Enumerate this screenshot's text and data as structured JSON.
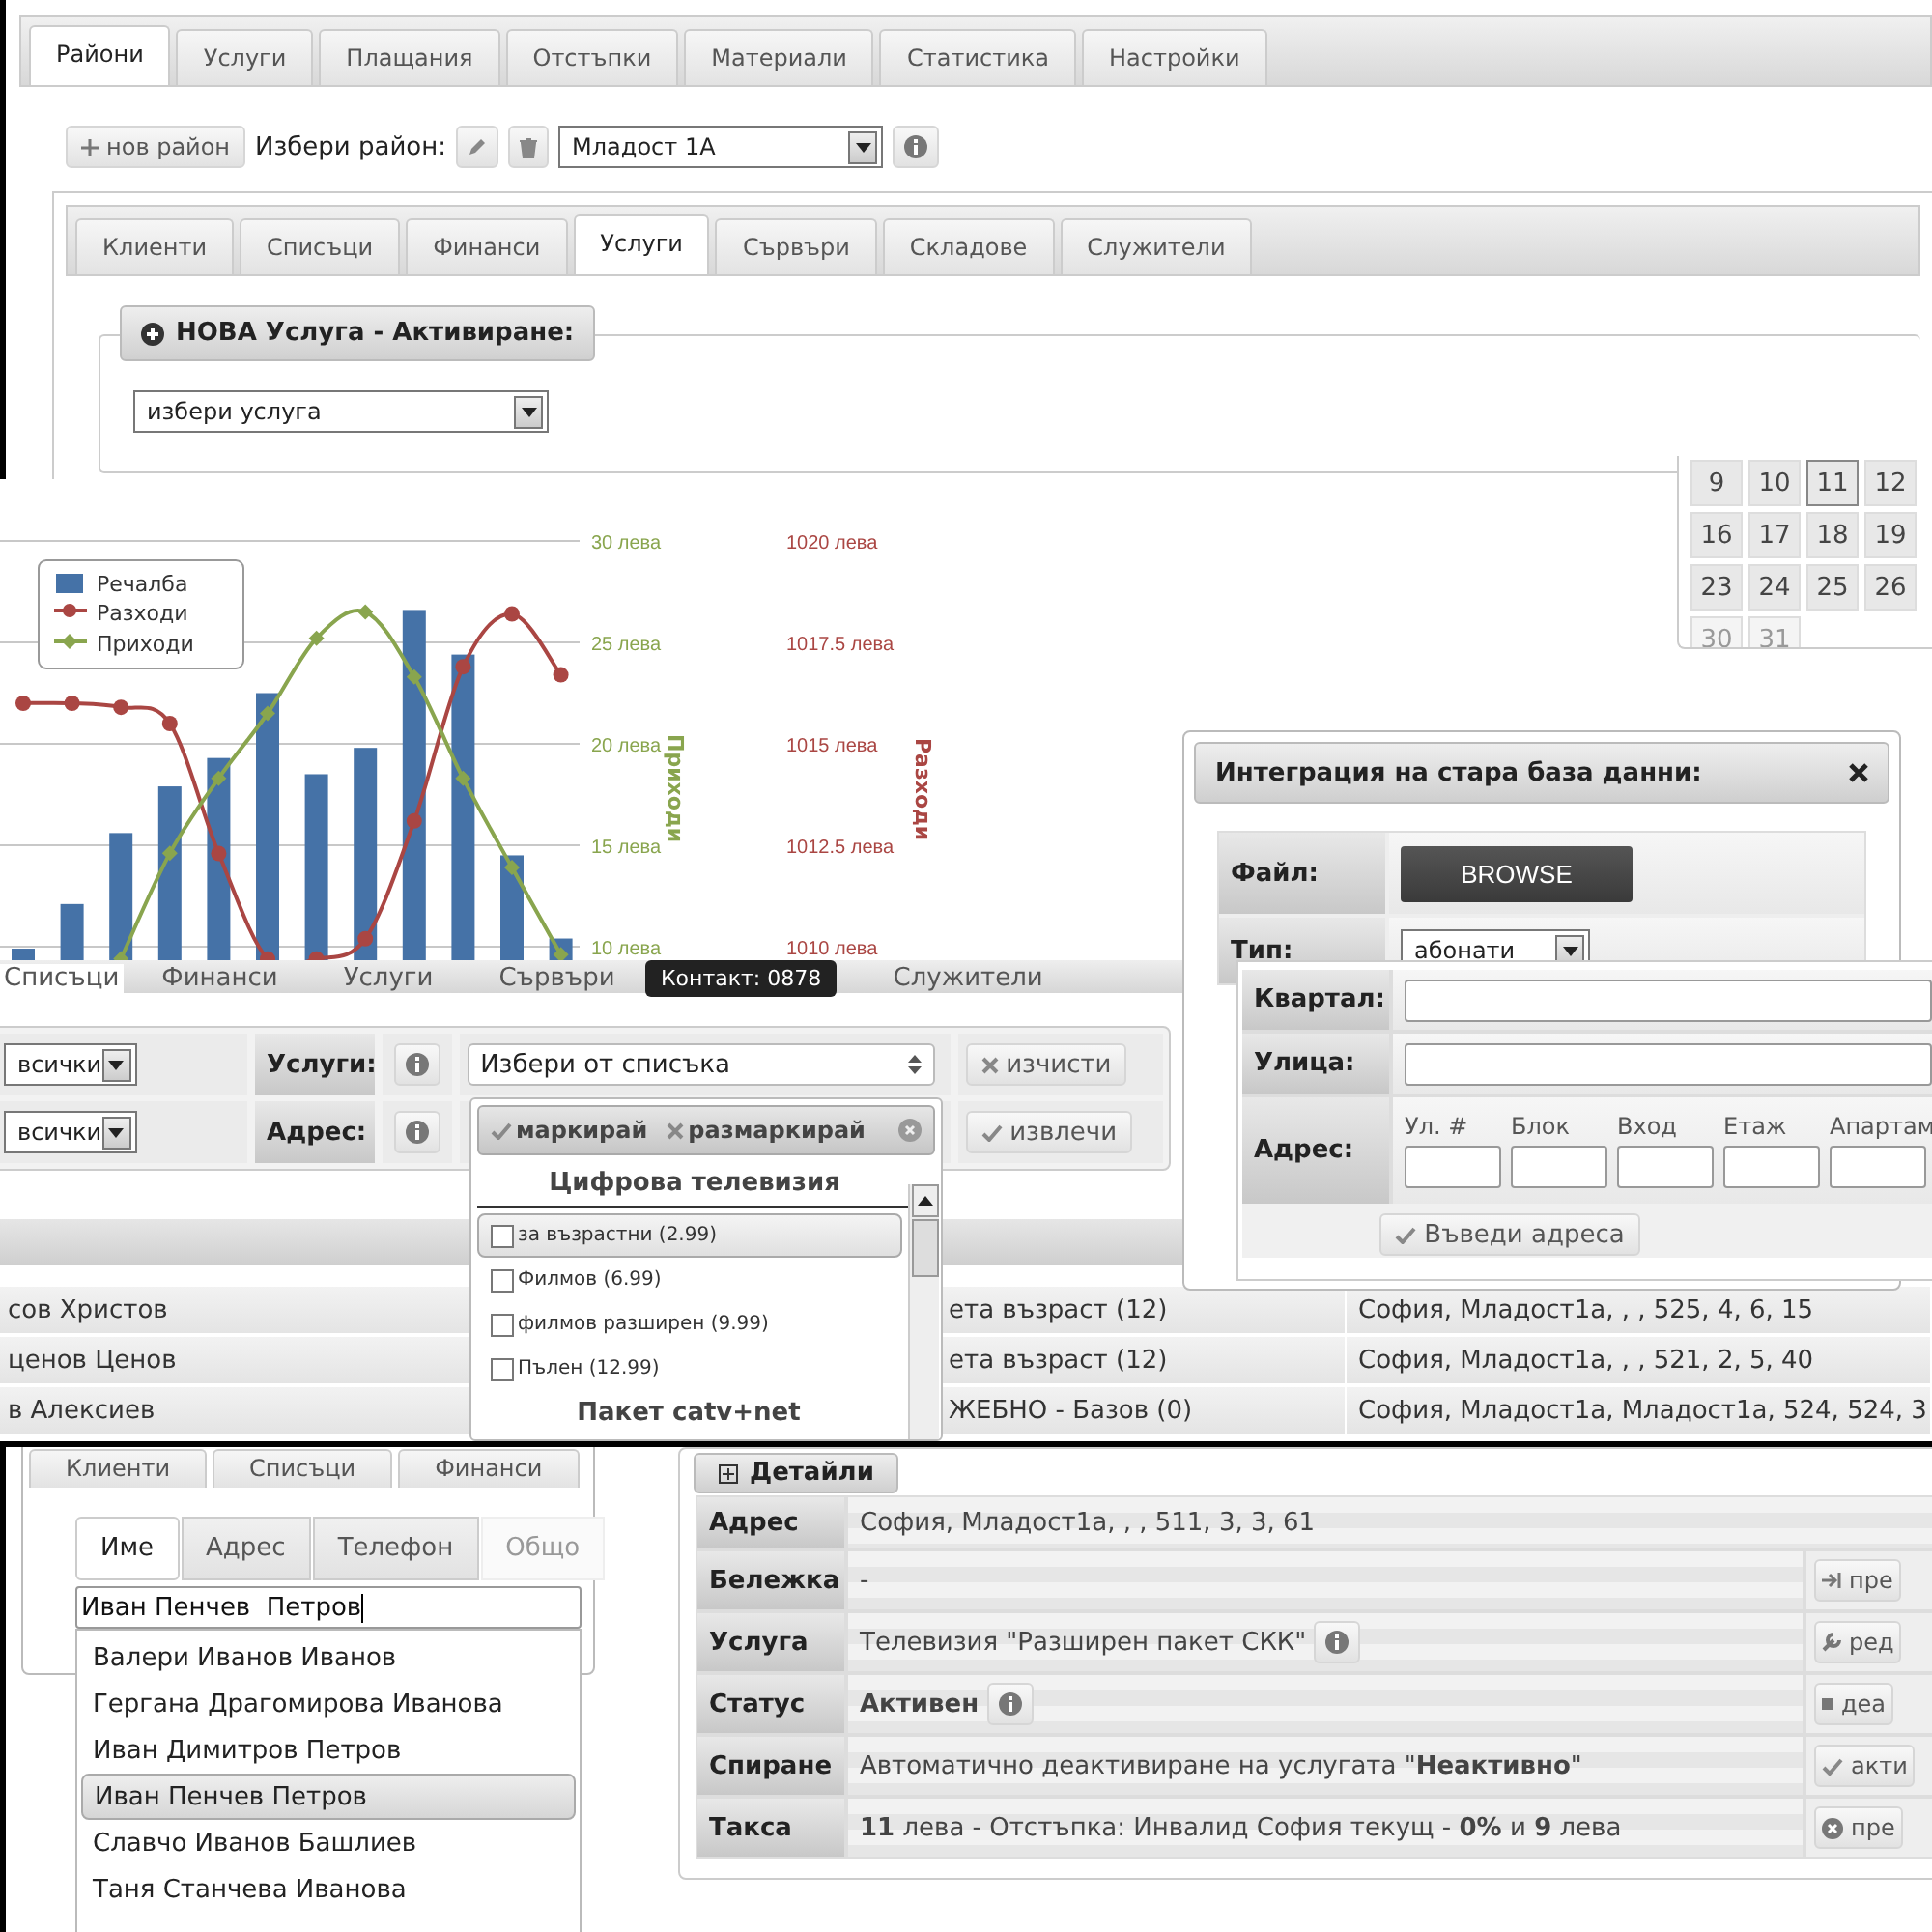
{
  "main_panel": {
    "tabs": [
      {
        "label": "Райони",
        "selected": true
      },
      {
        "label": "Услуги",
        "selected": false
      },
      {
        "label": "Плащания",
        "selected": false
      },
      {
        "label": "Отстъпки",
        "selected": false
      },
      {
        "label": "Материали",
        "selected": false
      },
      {
        "label": "Статистика",
        "selected": false
      },
      {
        "label": "Настройки",
        "selected": false
      }
    ],
    "new_button": "нов район",
    "district_label": "Избери район:",
    "district_select": "Младост 1А",
    "sub_tabs": [
      {
        "label": "Клиенти",
        "selected": false
      },
      {
        "label": "Списъци",
        "selected": false
      },
      {
        "label": "Финанси",
        "selected": false
      },
      {
        "label": "Услуги",
        "selected": true
      },
      {
        "label": "Сървъри",
        "selected": false
      },
      {
        "label": "Складове",
        "selected": false
      },
      {
        "label": "Служители",
        "selected": false
      }
    ],
    "new_service": {
      "legend": "НОВА Услуга - Активиране:",
      "select": "избери услуга"
    }
  },
  "calendar": {
    "weeks": [
      [
        {
          "day": "9",
          "selected": false,
          "disabled": false
        },
        {
          "day": "10",
          "selected": false,
          "disabled": false
        },
        {
          "day": "11",
          "selected": true,
          "disabled": false
        },
        {
          "day": "12",
          "selected": false,
          "disabled": false
        }
      ],
      [
        {
          "day": "16",
          "selected": false,
          "disabled": false
        },
        {
          "day": "17",
          "selected": false,
          "disabled": false
        },
        {
          "day": "18",
          "selected": false,
          "disabled": false
        },
        {
          "day": "19",
          "selected": false,
          "disabled": false
        }
      ],
      [
        {
          "day": "23",
          "selected": false,
          "disabled": false
        },
        {
          "day": "24",
          "selected": false,
          "disabled": false
        },
        {
          "day": "25",
          "selected": false,
          "disabled": false
        },
        {
          "day": "26",
          "selected": false,
          "disabled": false
        }
      ],
      [
        {
          "day": "30",
          "selected": false,
          "disabled": true
        },
        {
          "day": "31",
          "selected": false,
          "disabled": true
        }
      ]
    ]
  },
  "chart": {
    "chart_data": {
      "type": "bar",
      "grid": true,
      "legend": "upper left",
      "ylabel": "Приходи",
      "ylim": [
        9.33,
        33.05
      ],
      "yticks": [
        {
          "value": 10,
          "label": "10 лева"
        },
        {
          "value": 15,
          "label": "15 лева"
        },
        {
          "value": 20,
          "label": "20 лева"
        },
        {
          "value": 25,
          "label": "25 лева"
        },
        {
          "value": 30,
          "label": "30 лева"
        }
      ],
      "y2label": "Разходи",
      "y2lim": [
        1009.67,
        1021.52
      ],
      "y2ticks": [
        {
          "value": 1010,
          "label": "1010 лева"
        },
        {
          "value": 1012.5,
          "label": "1012.5 лева"
        },
        {
          "value": 1015,
          "label": "1015 лева"
        },
        {
          "value": 1017.5,
          "label": "1017.5 лева"
        },
        {
          "value": 1020,
          "label": "1020 лева"
        }
      ],
      "series": [
        {
          "name": "Речалба",
          "color": "#4572a7",
          "values": [
            9.9,
            12.1,
            15.6,
            17.9,
            19.3,
            22.5,
            18.5,
            19.8,
            26.6,
            24.4,
            14.5,
            10.4
          ]
        },
        {
          "name": "Разходи",
          "type": "line",
          "axis": "y2",
          "marker": "circle",
          "color": "#aa4643",
          "values": [
            1016.0,
            1016.0,
            1015.9,
            1015.5,
            1012.3,
            1009.7,
            1009.7,
            1010.2,
            1013.1,
            1016.9,
            1018.2,
            1016.7
          ]
        },
        {
          "name": "Приходи",
          "type": "line",
          "marker": "diamond",
          "color": "#89a54e",
          "values": [
            null,
            null,
            9.4,
            14.6,
            18.3,
            21.5,
            25.2,
            26.5,
            23.3,
            18.3,
            13.9,
            9.6
          ]
        }
      ]
    }
  },
  "tooltip": "Контакт: 0878",
  "clients_panel": {
    "tabs": [
      {
        "label": "Списъци",
        "selected": true
      },
      {
        "label": "Финанси",
        "selected": false
      },
      {
        "label": "Услуги",
        "selected": false
      },
      {
        "label": "Сървъри",
        "selected": false
      },
      {
        "label": "Служители",
        "selected": false
      }
    ],
    "filters": [
      {
        "select": "всички",
        "label": "Услуги:",
        "action": "изчисти"
      },
      {
        "select": "всички",
        "label": "Адрес:",
        "action": "извлечи"
      }
    ],
    "service_select": "Избери от списъка",
    "multiselect": {
      "check_all": "маркирай",
      "uncheck_all": "размаркирай",
      "groups": [
        {
          "name": "Цифрова телевизия",
          "options": [
            {
              "label": "за възрастни (2.99)",
              "checked": false,
              "selected": true
            },
            {
              "label": "Филмов (6.99)",
              "checked": false,
              "selected": false
            },
            {
              "label": "филмов разширен (9.99)",
              "checked": false,
              "selected": false
            },
            {
              "label": "Пълен (12.99)",
              "checked": false,
              "selected": false
            }
          ]
        },
        {
          "name": "Пакет catv+net"
        }
      ]
    },
    "table": {
      "rows": [
        [
          "сов Христов",
          "ета възраст (12)",
          "София, Младост1а, , , 525, 4, 6, 15"
        ],
        [
          "ценов Ценов",
          "ета възраст (12)",
          "София, Младост1а, , , 521, 2, 5, 40"
        ],
        [
          "в Алексиев",
          "ЖЕБНО - Базов (0)",
          "София, Младост1а, Младост1а, 524, 524, 3"
        ]
      ]
    }
  },
  "import_dialog": {
    "title": "Интеграция на стара база данни:",
    "file_label": "Файл:",
    "browse": "BROWSE",
    "type_label": "Тип:",
    "type_select": "абонати"
  },
  "address_panel": {
    "rows": [
      "Квартал:",
      "Улица:"
    ],
    "address_label": "Адрес:",
    "fields": [
      "Ул. #",
      "Блок",
      "Вход",
      "Етаж",
      "Апартам"
    ],
    "submit": "Въведи адреса"
  },
  "search_panel": {
    "tabs": [
      "Клиенти",
      "Списъци",
      "Финанси"
    ],
    "search_tabs": [
      {
        "label": "Име",
        "selected": true,
        "disabled": false
      },
      {
        "label": "Адрес",
        "selected": false,
        "disabled": false
      },
      {
        "label": "Телефон",
        "selected": false,
        "disabled": false
      },
      {
        "label": "Общо",
        "selected": false,
        "disabled": true
      }
    ],
    "query": "Иван Пенчев  Петров",
    "suggestions": [
      {
        "name": "Валери Иванов Иванов",
        "selected": false
      },
      {
        "name": "Гергана Драгомирова Иванова",
        "selected": false
      },
      {
        "name": "Иван Димитров Петров",
        "selected": false
      },
      {
        "name": "Иван Пенчев Петров",
        "selected": true
      },
      {
        "name": "Славчо Иванов Башлиев",
        "selected": false
      },
      {
        "name": "Таня Станчева Иванова",
        "selected": false
      }
    ]
  },
  "details": {
    "legend": "Детайли",
    "rows": [
      {
        "label": "Адрес",
        "value": "София, Младост1а, , , 511, 3, 3, 61",
        "info": false
      },
      {
        "label": "Бележка",
        "value": "-",
        "info": false,
        "action": "пре"
      },
      {
        "label": "Услуга",
        "value": "Телевизия \"Разширен пакет СКК\"",
        "info": true,
        "action": "ред"
      },
      {
        "label": "Статус",
        "value": "Активен",
        "info": true,
        "action": "деа",
        "kind": "status"
      },
      {
        "label": "Спиране",
        "value": "Автоматично деактивиране на услугата \"**Неактивно**\"",
        "info": false,
        "action": "акти"
      },
      {
        "label": "Такса",
        "value": "**11** лева - Отстъпка: Инвалид София текущ - **0%** и **9** лева",
        "info": false,
        "action": "пре"
      }
    ]
  }
}
